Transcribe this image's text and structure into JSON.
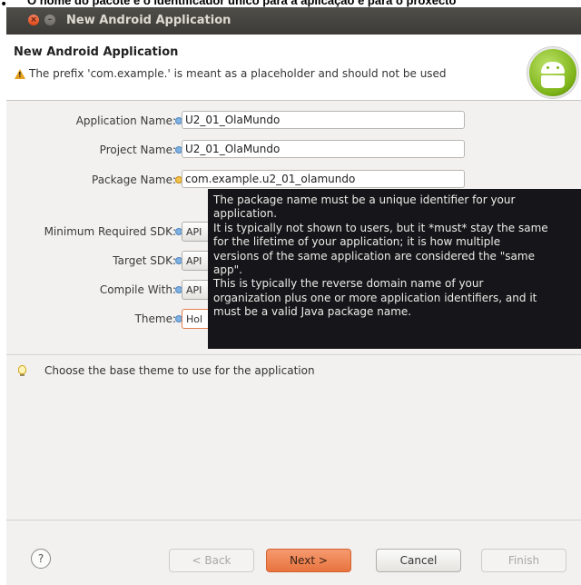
{
  "page_caption": "O nome do pacote é o identificador único para a aplicação e para o proxecto",
  "window": {
    "title": "New Android Application"
  },
  "header": {
    "title": "New Android Application",
    "warning": "The prefix 'com.example.' is meant as a placeholder and should not be used"
  },
  "form": {
    "application_name": {
      "label": "Application Name:",
      "value": "U2_01_OlaMundo"
    },
    "project_name": {
      "label": "Project Name:",
      "value": "U2_01_OlaMundo"
    },
    "package_name": {
      "label": "Package Name:",
      "value": "com.example.u2_01_olamundo"
    },
    "min_sdk": {
      "label": "Minimum Required SDK:",
      "value": "API"
    },
    "target_sdk": {
      "label": "Target SDK:",
      "value": "API"
    },
    "compile_with": {
      "label": "Compile With:",
      "value": "API"
    },
    "theme": {
      "label": "Theme:",
      "value": "Hol"
    }
  },
  "tooltip": {
    "lines": [
      "The package name must be a unique identifier for your",
      "application.",
      "It is typically not shown to users, but it *must* stay the same",
      "for the lifetime of your application; it is how multiple",
      "versions of the same application are considered the \"same",
      "app\".",
      "This is typically the reverse domain name of your",
      "organization plus one or more application identifiers, and it",
      "must be a valid Java package name."
    ]
  },
  "hint": {
    "text": "Choose the base theme to use for the application"
  },
  "footer": {
    "help": "?",
    "back": "< Back",
    "next": "Next >",
    "cancel": "Cancel",
    "finish": "Finish"
  },
  "colors": {
    "titlebar": "#3c3b37",
    "next_button": "#e8733e",
    "tooltip_bg": "#16161a"
  }
}
